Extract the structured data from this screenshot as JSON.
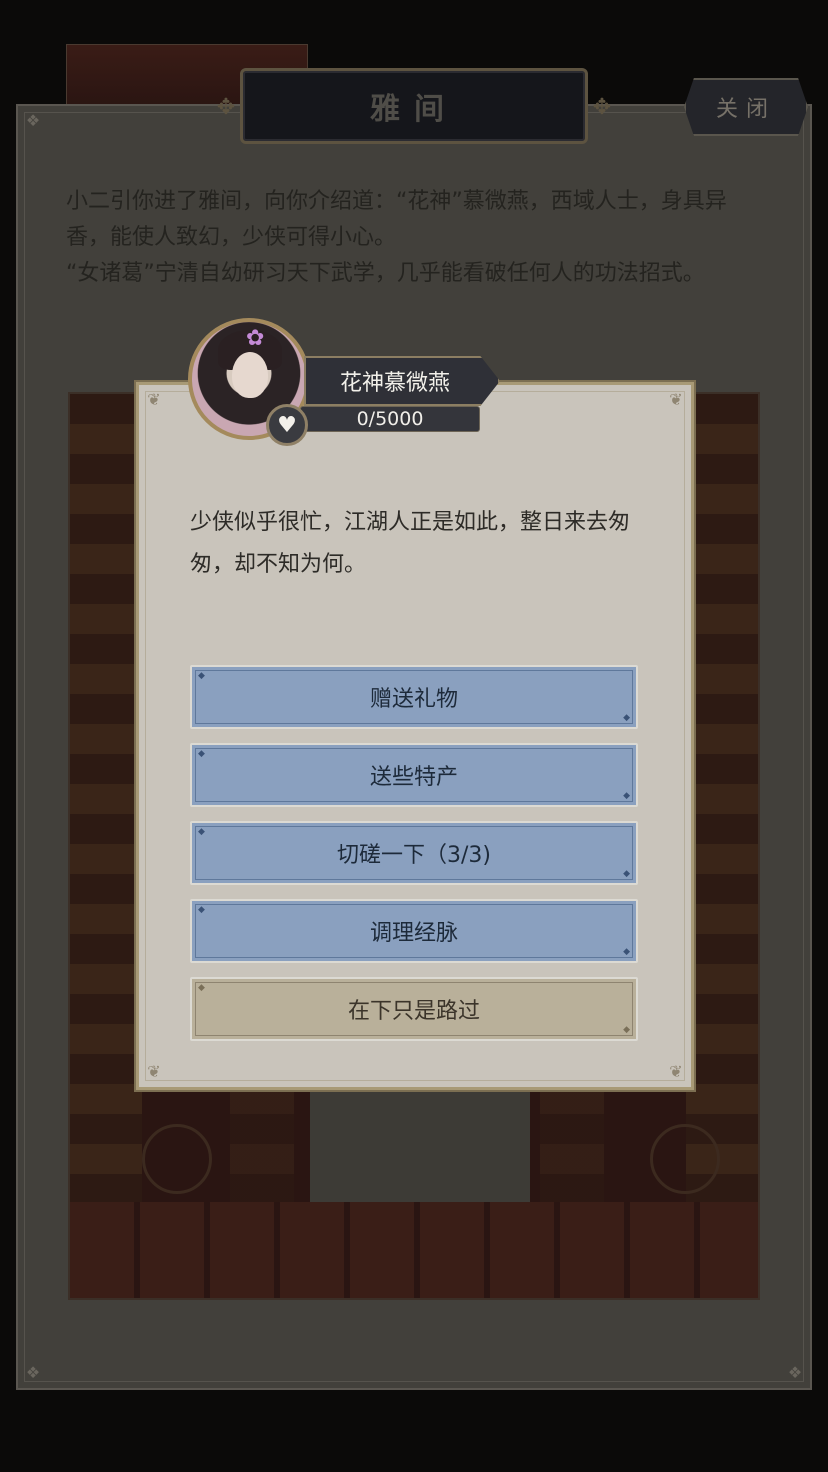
{
  "header": {
    "title": "雅间",
    "close_label": "关闭"
  },
  "intro": {
    "line1": "小二引你进了雅间，向你介绍道：“花神”慕微燕，西域人士，身具异香，能使人致幻，少侠可得小心。",
    "line2": "“女诸葛”宁清自幼研习天下武学，几乎能看破任何人的功法招式。"
  },
  "npc": {
    "name": "花神慕微燕",
    "affinity": "0/5000"
  },
  "dialog": {
    "text": "少侠似乎很忙，江湖人正是如此，整日来去匆匆，却不知为何。",
    "options": [
      {
        "label": "赠送礼物"
      },
      {
        "label": "送些特产"
      },
      {
        "label": "切磋一下（3/3)"
      },
      {
        "label": "调理经脉"
      },
      {
        "label": "在下只是路过"
      }
    ]
  },
  "colors": {
    "option_blue": "#8aa0bf",
    "option_tan": "#b9b09a",
    "dialog_bg": "#c9c4bb",
    "panel_dim": "#42403b"
  }
}
